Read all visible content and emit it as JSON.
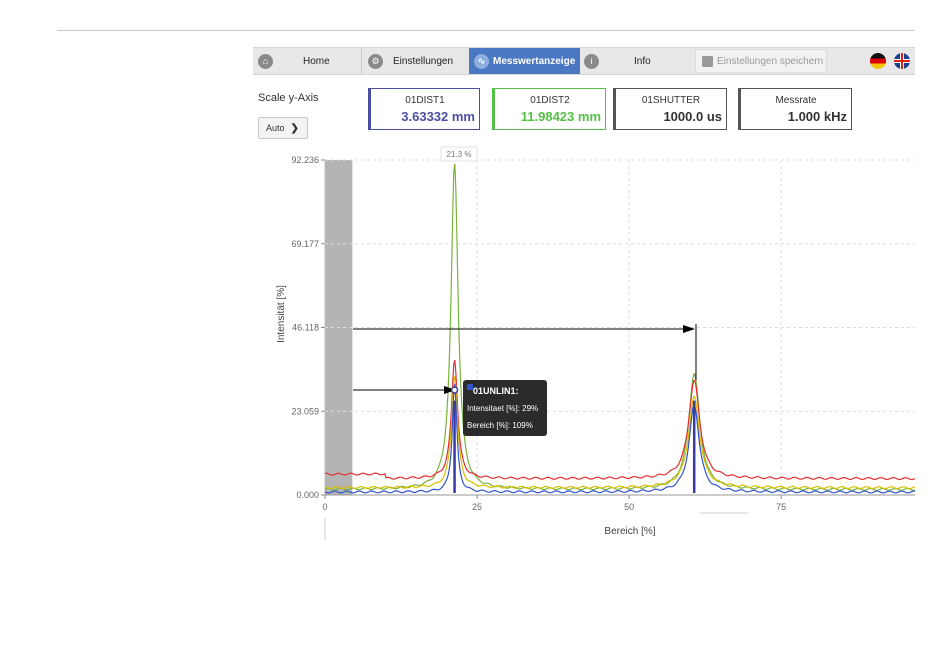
{
  "nav": {
    "home": "Home",
    "settings": "Einstellungen",
    "measure": "Messwertanzeige",
    "info": "Info",
    "save": "Einstellungen speichern"
  },
  "scale": {
    "label": "Scale y-Axis",
    "value": "Auto"
  },
  "values": [
    {
      "title": "01DIST1",
      "value": "3.63332 mm"
    },
    {
      "title": "01DIST2",
      "value": "11.98423 mm"
    },
    {
      "title": "01SHUTTER",
      "value": "1000.0 us"
    },
    {
      "title": "Messrate",
      "value": "1.000 kHz"
    }
  ],
  "colors": {
    "accent": "#4a78c2",
    "dist1": "#4b4fa3",
    "dist2": "#55c046",
    "red": "#e03030",
    "yellow": "#d8c000"
  },
  "chart_data": {
    "type": "line",
    "xlabel": "Bereich [%]",
    "ylabel": "Intensität [%]",
    "xlim": [
      0,
      97
    ],
    "ylim": [
      0,
      92.236
    ],
    "x_ticks": [
      "0",
      "25",
      "50",
      "75"
    ],
    "y_ticks": [
      "0.000",
      "23.059",
      "46.118",
      "69.177",
      "92.236"
    ],
    "peak_label": "21.3 %",
    "shaded_region": [
      0,
      4.5
    ],
    "dist_markers_x": [
      21.3,
      60.7
    ],
    "series": [
      {
        "color": "#7ab23c",
        "baseline": 1.5,
        "peaks": [
          [
            21.3,
            90,
            0.7
          ],
          [
            60.7,
            32,
            1.1
          ]
        ]
      },
      {
        "color": "#e03030",
        "baseline": 4.5,
        "peaks": [
          [
            21.3,
            33,
            0.6
          ],
          [
            60.7,
            27,
            1.1
          ]
        ]
      },
      {
        "color": "#d8c000",
        "baseline": 2.0,
        "peaks": [
          [
            21.3,
            31,
            0.6
          ],
          [
            60.7,
            25,
            1.1
          ]
        ]
      },
      {
        "color": "#3355cc",
        "baseline": 0.8,
        "peaks": [
          [
            21.3,
            30,
            0.45
          ],
          [
            60.7,
            24,
            1.0
          ]
        ]
      }
    ],
    "tooltip": {
      "title": "01UNLIN1:",
      "line1": "Intensitaet [%]: 29%",
      "line2": "Bereich [%]: 109%"
    }
  }
}
